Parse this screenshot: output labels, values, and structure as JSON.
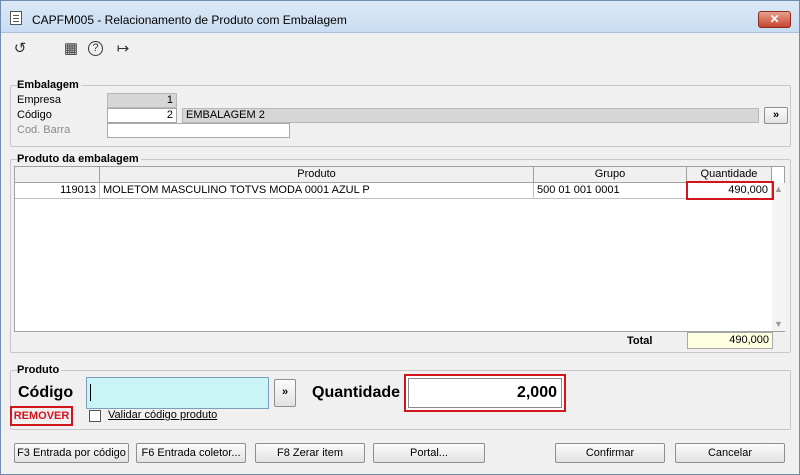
{
  "window": {
    "title": "CAPFM005 - Relacionamento de Produto com Embalagem",
    "close_label": "✕"
  },
  "toolbar": {
    "icons": [
      "refresh-icon",
      "calendar-icon",
      "help-icon",
      "exit-icon"
    ],
    "glyphs": {
      "refresh": "↺",
      "calendar": "▦",
      "help": "?",
      "exit": "↦"
    }
  },
  "embalagem": {
    "title": "Embalagem",
    "empresa_label": "Empresa",
    "empresa_value": "1",
    "codigo_label": "Código",
    "codigo_value": "2",
    "descricao_value": "EMBALAGEM 2",
    "lookup_label": "»",
    "codbarra_label": "Cod. Barra",
    "codbarra_value": ""
  },
  "produto_embalagem": {
    "title": "Produto da embalagem",
    "columns": [
      "Produto",
      "Grupo",
      "Quantidade"
    ],
    "rows": [
      {
        "codigo": "119013",
        "descricao": "MOLETOM MASCULINO TOTVS MODA 0001 AZUL P",
        "grupo": "500 01 001 0001",
        "quantidade": "490,000"
      }
    ],
    "total_label": "Total",
    "total_value": "490,000"
  },
  "produto": {
    "title": "Produto",
    "codigo_label": "Código",
    "codigo_value": "",
    "lookup_label": "»",
    "quantidade_label": "Quantidade",
    "quantidade_value": "2,000",
    "remover_label": "REMOVER",
    "validar_label": "Validar código produto",
    "validar_checked": false
  },
  "footer": {
    "f3": "F3 Entrada por código",
    "f6": "F6 Entrada coletor...",
    "f8": "F8 Zerar item",
    "portal": "Portal...",
    "confirmar": "Confirmar",
    "cancelar": "Cancelar"
  },
  "colors": {
    "highlight_red": "#d2141d",
    "code_input_bg": "#c9f5f6",
    "total_bg": "#ffffe1"
  }
}
